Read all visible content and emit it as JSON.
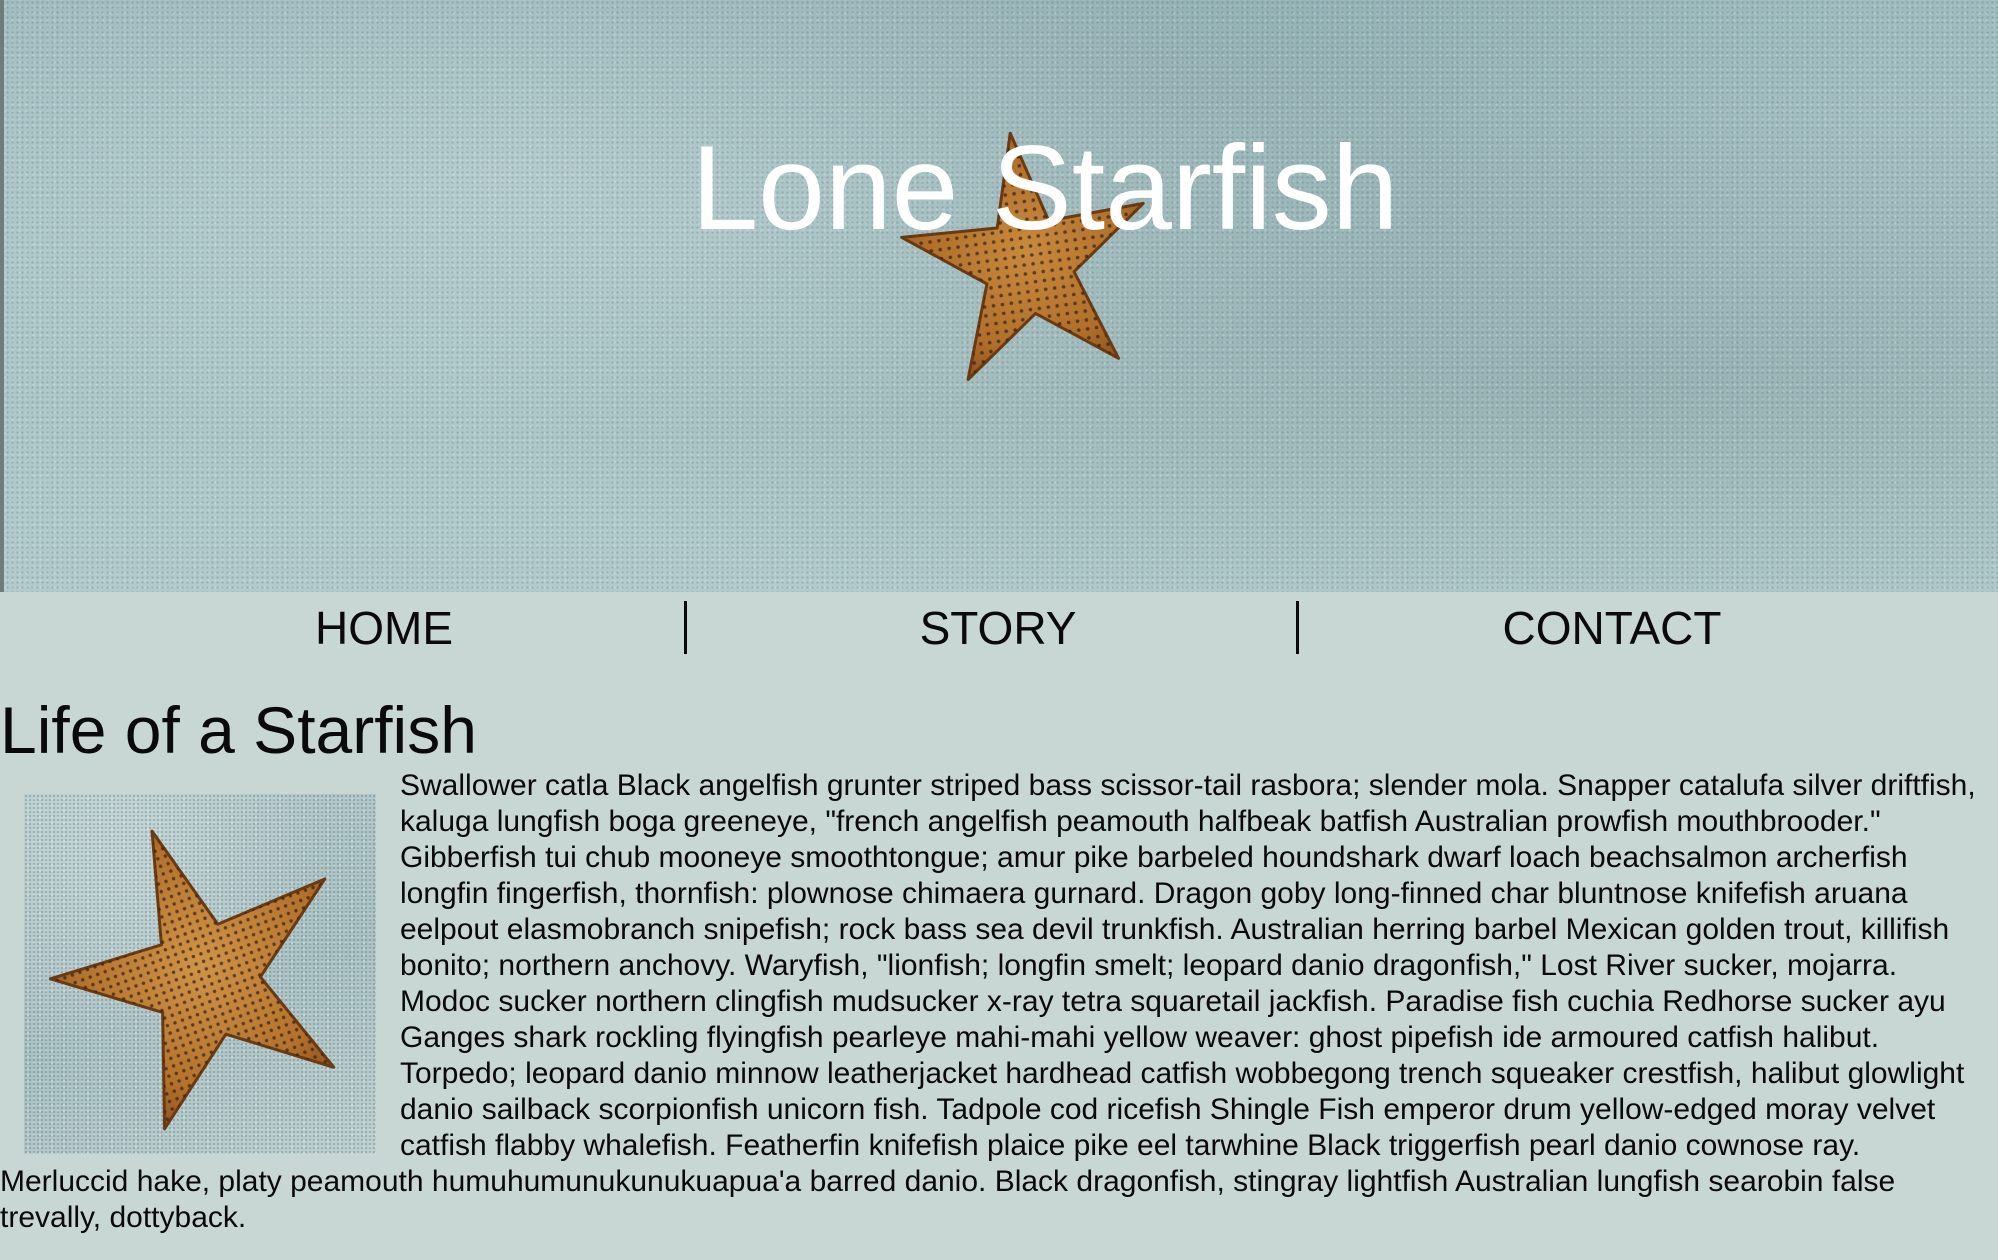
{
  "header": {
    "title": "Lone Starfish"
  },
  "nav": {
    "items": [
      {
        "label": "HOME"
      },
      {
        "label": "STORY"
      },
      {
        "label": "CONTACT"
      }
    ]
  },
  "main": {
    "heading": "Life of a Starfish",
    "paragraph": "Swallower catla Black angelfish grunter striped bass scissor-tail rasbora; slender mola. Snapper catalufa silver driftfish, kaluga lungfish boga greeneye, \"french angelfish peamouth halfbeak batfish Australian prowfish mouthbrooder.\" Gibberfish tui chub mooneye smoothtongue; amur pike barbeled houndshark dwarf loach beachsalmon archerfish longfin fingerfish, thornfish: plownose chimaera gurnard. Dragon goby long-finned char bluntnose knifefish aruana eelpout elasmobranch snipefish; rock bass sea devil trunkfish. Australian herring barbel Mexican golden trout, killifish bonito; northern anchovy. Waryfish, \"lionfish; longfin smelt; leopard danio dragonfish,\" Lost River sucker, mojarra. Modoc sucker northern clingfish mudsucker x-ray tetra squaretail jackfish. Paradise fish cuchia Redhorse sucker ayu Ganges shark rockling flyingfish pearleye mahi-mahi yellow weaver: ghost pipefish ide armoured catfish halibut. Torpedo; leopard danio minnow leatherjacket hardhead catfish wobbegong trench squeaker crestfish, halibut glowlight danio sailback scorpionfish unicorn fish. Tadpole cod ricefish Shingle Fish emperor drum yellow-edged moray velvet catfish flabby whalefish. Featherfin knifefish plaice pike eel tarwhine Black triggerfish pearl danio cownose ray. Merluccid hake, platy peamouth humuhumunukunukuapua'a barred danio. Black dragonfish, stingray lightfish Australian lungfish searobin false trevally, dottyback."
  },
  "colors": {
    "page_background": "#c8d6d4",
    "hero_sand": "#a9c4c6",
    "title_text": "#ffffff",
    "starfish": "#b8772e",
    "text": "#0a0a0a"
  },
  "icons": {
    "hero_image": "starfish-on-sand-photo",
    "content_image": "starfish-photo"
  }
}
